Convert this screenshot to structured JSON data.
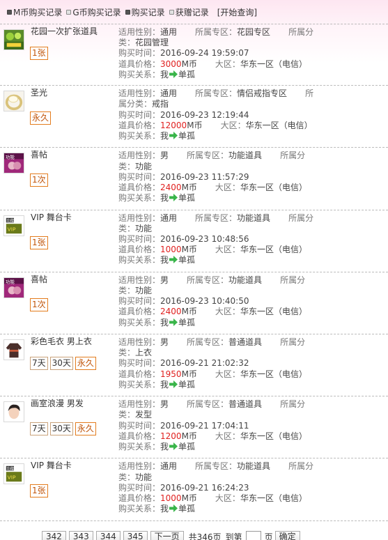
{
  "tabs": [
    {
      "label": "M币购买记录",
      "checked": true
    },
    {
      "label": "G币购买记录",
      "checked": false
    },
    {
      "label": "购买记录",
      "checked": true
    },
    {
      "label": "获赠记录",
      "checked": false
    }
  ],
  "query_label": "[开始查询]",
  "field_labels": {
    "gender": "适用性别：",
    "zone": "所属专区：",
    "category": "所属分类：",
    "time": "购买时间：",
    "price": "道具价格：",
    "region": "大区：",
    "relation": "购买关系："
  },
  "records": [
    {
      "name": "花园一次扩张道具",
      "icon": "garden-expand-icon",
      "durations": [
        "1张"
      ],
      "gender": "通用",
      "zone": "花园专区",
      "category": "花园管理",
      "time": "2016-09-24 19:59:07",
      "price_num": "3000",
      "price_unit": "M币",
      "region": "华东一区（电信）",
      "buyer": "我",
      "target": "单孤"
    },
    {
      "name": "圣光",
      "icon": "ring-icon",
      "durations": [
        "永久"
      ],
      "gender": "通用",
      "zone": "情侣戒指专区",
      "category": "戒指",
      "time": "2016-09-23 12:19:44",
      "price_num": "12000",
      "price_unit": "M币",
      "region": "华东一区（电信）",
      "buyer": "我",
      "target": "单孤"
    },
    {
      "name": "喜帖",
      "icon": "invitation-icon",
      "durations": [
        "1次"
      ],
      "gender": "男",
      "zone": "功能道具",
      "category": "功能",
      "time": "2016-09-23 11:57:29",
      "price_num": "2400",
      "price_unit": "M币",
      "region": "华东一区（电信）",
      "buyer": "我",
      "target": "单孤"
    },
    {
      "name": "VIP 舞台卡",
      "icon": "vip-card-icon",
      "durations": [
        "1张"
      ],
      "gender": "通用",
      "zone": "功能道具",
      "category": "功能",
      "time": "2016-09-23 10:48:56",
      "price_num": "1000",
      "price_unit": "M币",
      "region": "华东一区（电信）",
      "buyer": "我",
      "target": "单孤"
    },
    {
      "name": "喜帖",
      "icon": "invitation-icon",
      "durations": [
        "1次"
      ],
      "gender": "男",
      "zone": "功能道具",
      "category": "功能",
      "time": "2016-09-23 10:40:50",
      "price_num": "2400",
      "price_unit": "M币",
      "region": "华东一区（电信）",
      "buyer": "我",
      "target": "单孤"
    },
    {
      "name": "彩色毛衣 男上衣",
      "icon": "sweater-icon",
      "durations": [
        "7天",
        "30天",
        "永久"
      ],
      "gender": "男",
      "zone": "普通道具",
      "category": "上衣",
      "time": "2016-09-21 21:02:32",
      "price_num": "1950",
      "price_unit": "M币",
      "region": "华东一区（电信）",
      "buyer": "我",
      "target": "单孤"
    },
    {
      "name": "画室浪漫 男发",
      "icon": "hair-icon",
      "durations": [
        "7天",
        "30天",
        "永久"
      ],
      "gender": "男",
      "zone": "普通道具",
      "category": "发型",
      "time": "2016-09-21 17:04:11",
      "price_num": "1200",
      "price_unit": "M币",
      "region": "华东一区（电信）",
      "buyer": "我",
      "target": "单孤"
    },
    {
      "name": "VIP 舞台卡",
      "icon": "vip-card-icon",
      "durations": [
        "1张"
      ],
      "gender": "通用",
      "zone": "功能道具",
      "category": "功能",
      "time": "2016-09-21 16:24:23",
      "price_num": "1000",
      "price_unit": "M币",
      "region": "华东一区（电信）",
      "buyer": "我",
      "target": "单孤"
    }
  ],
  "pager": {
    "pages": [
      "342",
      "343",
      "344",
      "345"
    ],
    "next_label": "下一页",
    "total_label": "共346页",
    "goto_prefix": "到第",
    "goto_suffix": "页",
    "confirm_label": "确定"
  },
  "colors": {
    "price": "#e0201f",
    "accent_border": "#e37b1c",
    "arrow": "#39b54a"
  }
}
